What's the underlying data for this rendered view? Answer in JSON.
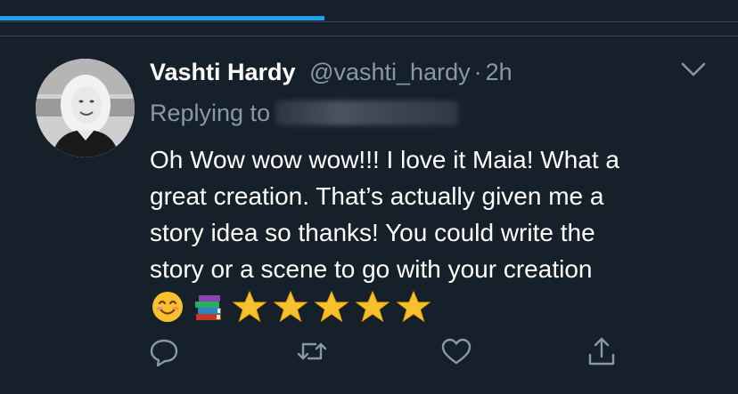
{
  "progress": {
    "fraction": 0.44,
    "color": "#1da1f2"
  },
  "tweet": {
    "author_name": "Vashti Hardy",
    "author_handle": "@vashti_hardy",
    "separator": "·",
    "time": "2h",
    "replying_prefix": "Replying to",
    "body_lines": [
      "Oh Wow wow wow!!! I love it Maia! What a",
      "great creation. That’s actually given me a",
      "story idea so thanks! You could write the",
      "story or a scene to go with your creation"
    ],
    "emojis": [
      "smiling-face",
      "books",
      "star",
      "star",
      "star",
      "star",
      "star"
    ]
  },
  "actions": [
    "reply-icon",
    "retweet-icon",
    "like-icon",
    "share-icon"
  ],
  "colors": {
    "background": "#15202b",
    "text": "#ffffff",
    "secondary": "#8899a6",
    "accent": "#1da1f2",
    "divider": "#38444d"
  }
}
